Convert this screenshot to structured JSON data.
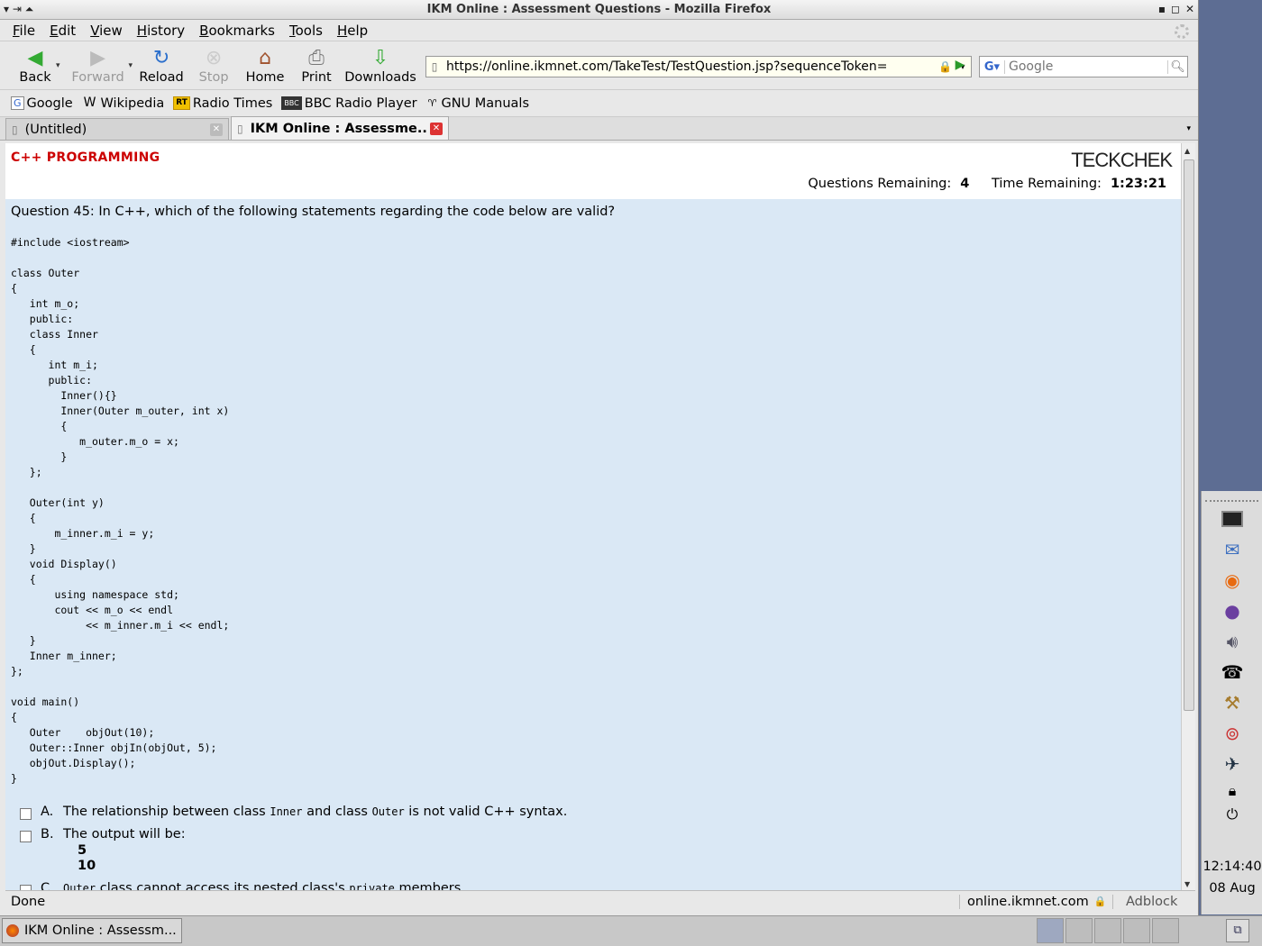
{
  "window": {
    "title": "IKM Online : Assessment Questions - Mozilla Firefox"
  },
  "menu": [
    "File",
    "Edit",
    "View",
    "History",
    "Bookmarks",
    "Tools",
    "Help"
  ],
  "toolbar": {
    "back": "Back",
    "forward": "Forward",
    "reload": "Reload",
    "stop": "Stop",
    "home": "Home",
    "print": "Print",
    "downloads": "Downloads",
    "url": "https://online.ikmnet.com/TakeTest/TestQuestion.jsp?sequenceToken=",
    "search_placeholder": "Google"
  },
  "bookmarks": [
    "Google",
    "Wikipedia",
    "Radio Times",
    "BBC Radio Player",
    "GNU Manuals"
  ],
  "tabs": [
    {
      "label": "(Untitled)",
      "active": false
    },
    {
      "label": "IKM Online : Assessme...",
      "active": true
    }
  ],
  "page": {
    "subject": "C++ PROGRAMMING",
    "logo": "TECKCHEK",
    "questions_remaining_label": "Questions Remaining:",
    "questions_remaining": "4",
    "time_remaining_label": "Time Remaining:",
    "time_remaining": "1:23:21",
    "question": "Question 45: In C++, which of the following statements regarding the code below are valid?",
    "code": "#include <iostream>\n\nclass Outer\n{\n   int m_o;\n   public:\n   class Inner\n   {\n      int m_i;\n      public:\n        Inner(){}\n        Inner(Outer m_outer, int x)\n        {\n           m_outer.m_o = x;\n        }\n   };\n\n   Outer(int y)\n   {\n       m_inner.m_i = y;\n   }\n   void Display()\n   {\n       using namespace std;\n       cout << m_o << endl\n            << m_inner.m_i << endl;\n   }\n   Inner m_inner;\n};\n\nvoid main()\n{\n   Outer    objOut(10);\n   Outer::Inner objIn(objOut, 5);\n   objOut.Display();\n}",
    "answers": {
      "a": {
        "letter": "A.",
        "t1": "The relationship between class ",
        "c1": "Inner",
        "t2": " and class ",
        "c2": "Outer",
        "t3": " is not valid C++ syntax."
      },
      "b": {
        "letter": "B.",
        "t1": "The output will be:",
        "out1": "5",
        "out2": "10"
      },
      "c": {
        "letter": "C.",
        "c1": "Outer",
        "t1": " class cannot access its nested class's ",
        "c2": "private",
        "t2": " members."
      }
    }
  },
  "status": {
    "text": "Done",
    "domain": "online.ikmnet.com",
    "adblock": "Adblock"
  },
  "taskbar": {
    "window_label": "IKM Online : Assessm..."
  },
  "clock": {
    "time": "12:14:40",
    "date": "08 Aug"
  }
}
